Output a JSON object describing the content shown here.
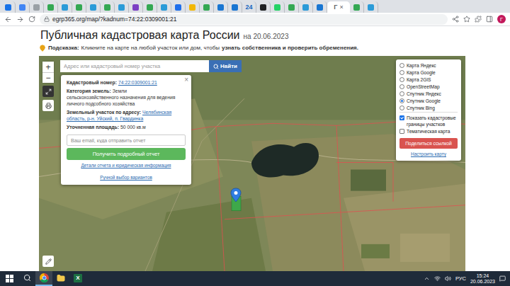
{
  "browser": {
    "tabs": [
      {
        "label": "",
        "color": "#1a73e8",
        "selected": false
      },
      {
        "label": "",
        "color": "#4285f4",
        "selected": false
      },
      {
        "label": "",
        "color": "#9aa0a6",
        "selected": false
      },
      {
        "label": "",
        "color": "#34a853",
        "selected": false
      },
      {
        "label": "",
        "color": "#2b9bd8",
        "selected": false
      },
      {
        "label": "",
        "color": "#34a853",
        "selected": false
      },
      {
        "label": "",
        "color": "#2b9bd8",
        "selected": false
      },
      {
        "label": "",
        "color": "#34a853",
        "selected": false
      },
      {
        "label": "",
        "color": "#2b9bd8",
        "selected": false
      },
      {
        "label": "",
        "color": "#7b3fc4",
        "selected": false
      },
      {
        "label": "",
        "color": "#34a853",
        "selected": false
      },
      {
        "label": "",
        "color": "#2b9bd8",
        "selected": false
      },
      {
        "label": "",
        "color": "#1f6feb",
        "selected": false
      },
      {
        "label": "",
        "color": "#f2b705",
        "selected": false
      },
      {
        "label": "",
        "color": "#34a853",
        "selected": false
      },
      {
        "label": "",
        "color": "#1976d2",
        "selected": false
      },
      {
        "label": "",
        "color": "#1976d2",
        "selected": false
      },
      {
        "label": "24",
        "color": "#1565c0",
        "selected": false
      },
      {
        "label": "",
        "color": "#202124",
        "selected": false
      },
      {
        "label": "",
        "color": "#25d366",
        "selected": false
      },
      {
        "label": "",
        "color": "#34a853",
        "selected": false
      },
      {
        "label": "",
        "color": "#2b9bd8",
        "selected": false
      },
      {
        "label": "",
        "color": "#1976d2",
        "selected": false
      },
      {
        "label": "Г",
        "color": "#5f6368",
        "selected": true
      },
      {
        "label": "",
        "color": "#34a853",
        "selected": false
      },
      {
        "label": "",
        "color": "#2b9bd8",
        "selected": false
      }
    ],
    "close_glyph": "×",
    "address": "egrp365.org/map/?kadnum=74:22:0309001:21",
    "profile": "Г"
  },
  "page": {
    "title": "Публичная кадастровая карта России",
    "date": "на 20.06.2023",
    "hint_label": "Подсказка:",
    "hint_text": "Кликните на карте на любой участок или дом, чтобы",
    "hint_bold": "узнать собственника и проверить обременения."
  },
  "map": {
    "search": {
      "placeholder": "Адрес или кадастровый номер участка",
      "button": "Найти"
    },
    "zoom_in": "+",
    "zoom_out": "−",
    "popup": {
      "close": "×",
      "rows": [
        {
          "label": "Кадастровый номер:",
          "value": "74:22:0309001:21",
          "kind": "link"
        },
        {
          "label": "Категория земель:",
          "value": "Земли сельскохозяйственного назначения для ведения личного подсобного хозяйства",
          "kind": "text"
        },
        {
          "label": "Земельный участок по адресу:",
          "value": "Челябинская область, р-н. Уйский, п. Гвардинка",
          "kind": "link"
        },
        {
          "label": "Уточненная площадь:",
          "value": "50 000 кв.м",
          "kind": "text"
        }
      ],
      "email_placeholder": "Ваш email, куда отправить отчет",
      "report_button": "Получить подробный отчет",
      "details_link": "Детали отчета и юридическая информация",
      "manual_link": "Ручной выбор вариантов"
    },
    "layers": {
      "options": [
        {
          "label": "Карта Яндекс",
          "kind": "radio",
          "selected": false
        },
        {
          "label": "Карта Google",
          "kind": "radio",
          "selected": false
        },
        {
          "label": "Карта 2GIS",
          "kind": "radio",
          "selected": false
        },
        {
          "label": "OpenStreetMap",
          "kind": "radio",
          "selected": false
        },
        {
          "label": "Спутник Яндекс",
          "kind": "radio",
          "selected": false
        },
        {
          "label": "Спутник Google",
          "kind": "radio",
          "selected": true
        },
        {
          "label": "Спутник Bing",
          "kind": "radio",
          "selected": false
        },
        {
          "label": "Показать кадастровые границы участков",
          "kind": "checkbox",
          "selected": true
        },
        {
          "label": "Тематическая карта",
          "kind": "checkbox",
          "selected": false
        }
      ],
      "share_button": "Поделиться ссылкой",
      "config_link": "Настроить карту"
    }
  },
  "taskbar": {
    "excel": "X",
    "language": "РУС",
    "time": "15:24",
    "date": "20.06.2023"
  }
}
